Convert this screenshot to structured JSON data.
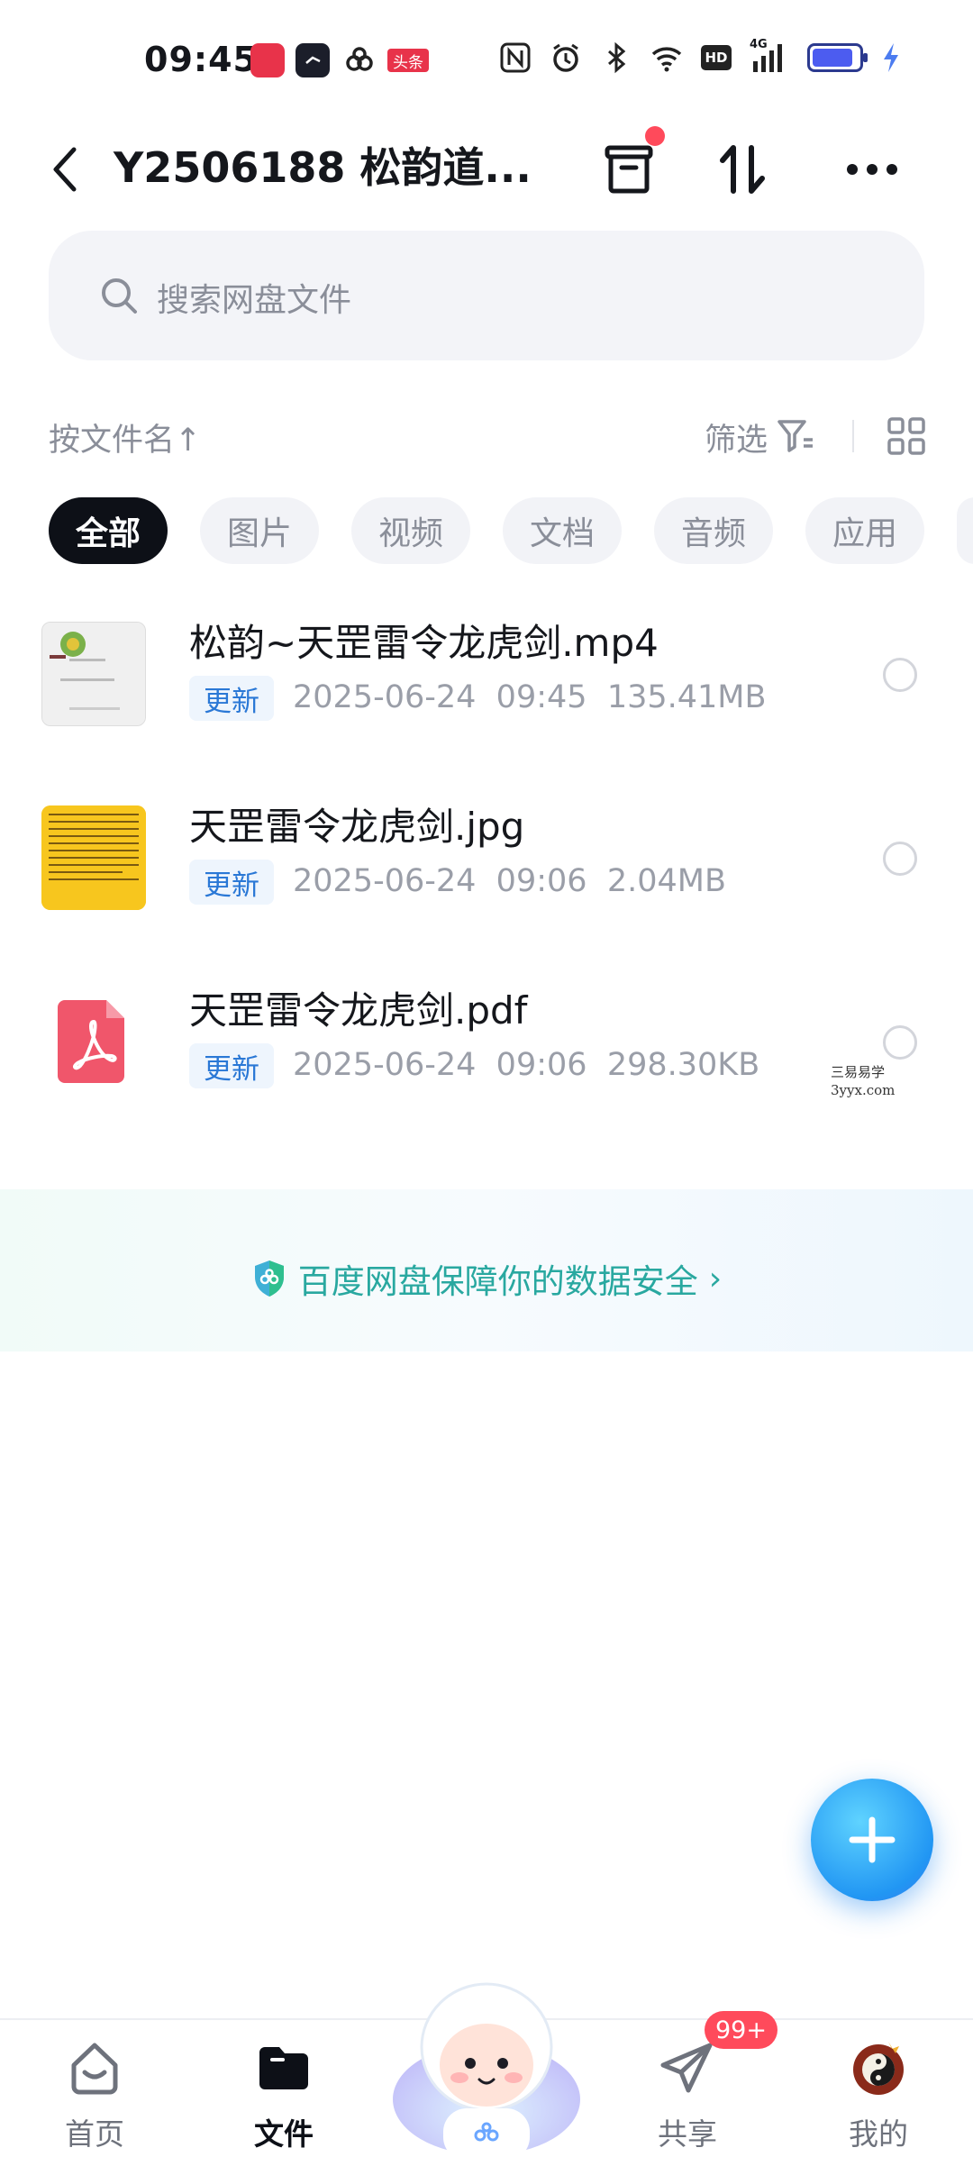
{
  "status_bar": {
    "time": "09:45",
    "apps": [
      "app-icon-red",
      "app-icon-clock",
      "app-icon-baidupan",
      "toutiao-icon"
    ],
    "toutiao_label": "头条",
    "signal_label": "4G",
    "hd_label": "HD",
    "battery_level": 0.9
  },
  "header": {
    "title": "Y2506188 松韵道...",
    "has_notification_dot": true
  },
  "search": {
    "placeholder": "搜索网盘文件"
  },
  "sort_row": {
    "sort_label": "按文件名",
    "sort_arrow": "↑",
    "filter_label": "筛选"
  },
  "chips": [
    {
      "label": "全部",
      "active": true
    },
    {
      "label": "图片",
      "active": false
    },
    {
      "label": "视频",
      "active": false
    },
    {
      "label": "文档",
      "active": false
    },
    {
      "label": "音频",
      "active": false
    },
    {
      "label": "应用",
      "active": false
    }
  ],
  "files": [
    {
      "name": "松韵~天罡雷令龙虎剑.mp4",
      "badge": "更新",
      "date": "2025-06-24",
      "time": "09:45",
      "size": "135.41MB",
      "type": "video"
    },
    {
      "name": "天罡雷令龙虎剑.jpg",
      "badge": "更新",
      "date": "2025-06-24",
      "time": "09:06",
      "size": "2.04MB",
      "type": "image"
    },
    {
      "name": "天罡雷令龙虎剑.pdf",
      "badge": "更新",
      "date": "2025-06-24",
      "time": "09:06",
      "size": "298.30KB",
      "type": "pdf"
    }
  ],
  "watermark": {
    "line1": "三易易学",
    "line2": "3yyx.com"
  },
  "banner": {
    "text": "百度网盘保障你的数据安全",
    "arrow": "›",
    "color": "#29a8a0"
  },
  "bottom_nav": {
    "items": [
      {
        "label": "首页",
        "active": false
      },
      {
        "label": "文件",
        "active": true
      },
      {
        "label": "共享",
        "active": false
      },
      {
        "label": "我的",
        "active": false
      }
    ],
    "share_badge": "99+"
  },
  "colors": {
    "accent": "#2196f3",
    "badge_red": "#ff4a5b",
    "update_badge_text": "#2a78d6"
  }
}
